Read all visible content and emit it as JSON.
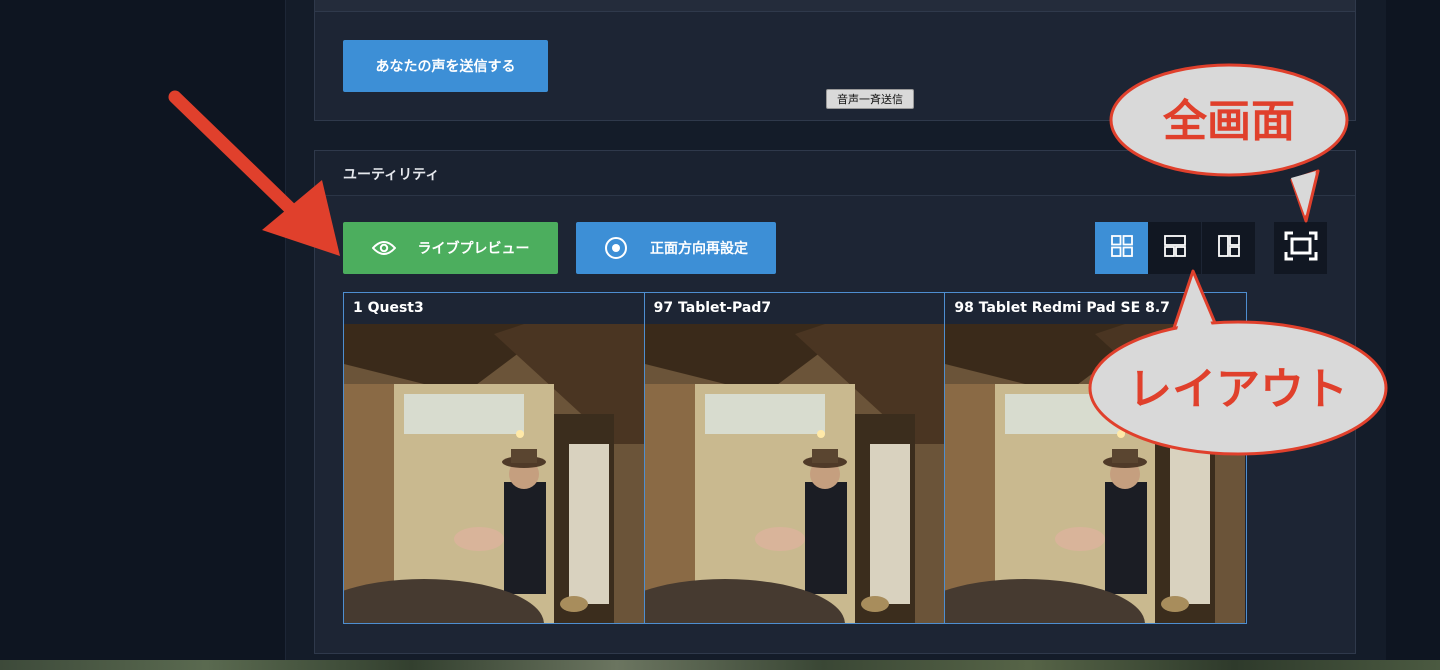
{
  "send_voice_button": "あなたの声を送信する",
  "tooltip": "音声一斉送信",
  "utility": {
    "title": "ユーティリティ",
    "live_preview_button": "ライブプレビュー",
    "reset_front_button": "正面方向再設定"
  },
  "layout_options": [
    "grid-2x2",
    "rows-split",
    "columns-split"
  ],
  "selected_layout": "grid-2x2",
  "devices": [
    {
      "label": "1 Quest3"
    },
    {
      "label": "97 Tablet-Pad7"
    },
    {
      "label": "98 Tablet Redmi Pad SE 8.7"
    }
  ],
  "annotations": {
    "fullscreen": "全画面",
    "layout": "レイアウト"
  },
  "colors": {
    "primary": "#3d8fd6",
    "success": "#4cae5e",
    "annotation": "#e0402c"
  }
}
